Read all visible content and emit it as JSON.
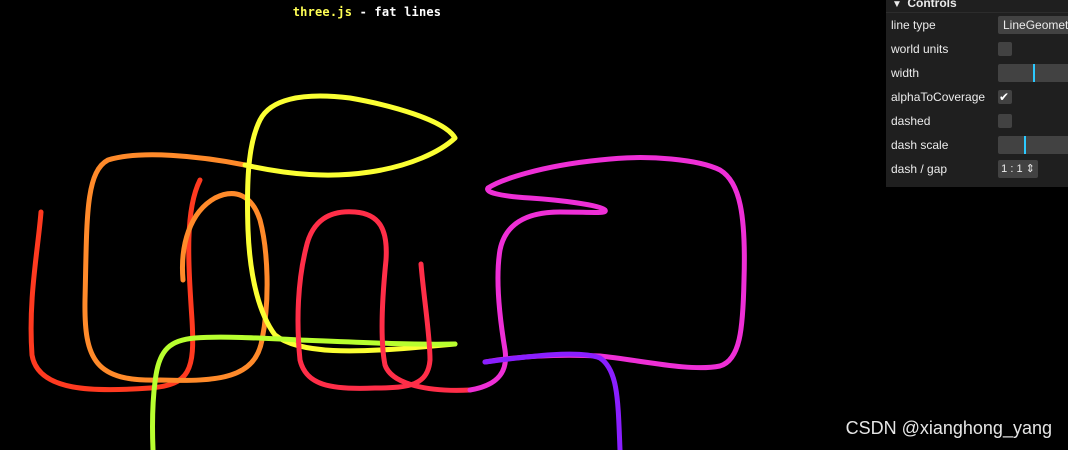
{
  "page": {
    "title_prefix": "three.js",
    "title_suffix": " - fat lines"
  },
  "gui": {
    "title": "Controls",
    "rows": [
      {
        "label": "line type",
        "control": "select",
        "value": "LineGeometry"
      },
      {
        "label": "world units",
        "control": "checkbox",
        "checked": false
      },
      {
        "label": "width",
        "control": "slider",
        "level": 0.49
      },
      {
        "label": "alphaToCoverage",
        "control": "checkbox",
        "checked": true
      },
      {
        "label": "dashed",
        "control": "checkbox",
        "checked": false
      },
      {
        "label": "dash scale",
        "control": "slider",
        "level": 0.36
      },
      {
        "label": "dash / gap",
        "control": "select",
        "value": "1 : 1"
      }
    ]
  },
  "watermark": "CSDN @xianghong_yang",
  "colors": {
    "background": "#000000",
    "title_highlight": "#ffff55",
    "gui_background": "#1f1f1f",
    "gui_control": "#424242",
    "slider_knob": "#2cc9ff"
  },
  "scene": {
    "description_icon": "fat-lines-curve",
    "gradient": [
      "#ff3b1f",
      "#ff9a2a",
      "#ffff44",
      "#a8ff2e",
      "#ff2a55",
      "#ff2fb0",
      "#c82cff",
      "#7a1cff"
    ]
  }
}
